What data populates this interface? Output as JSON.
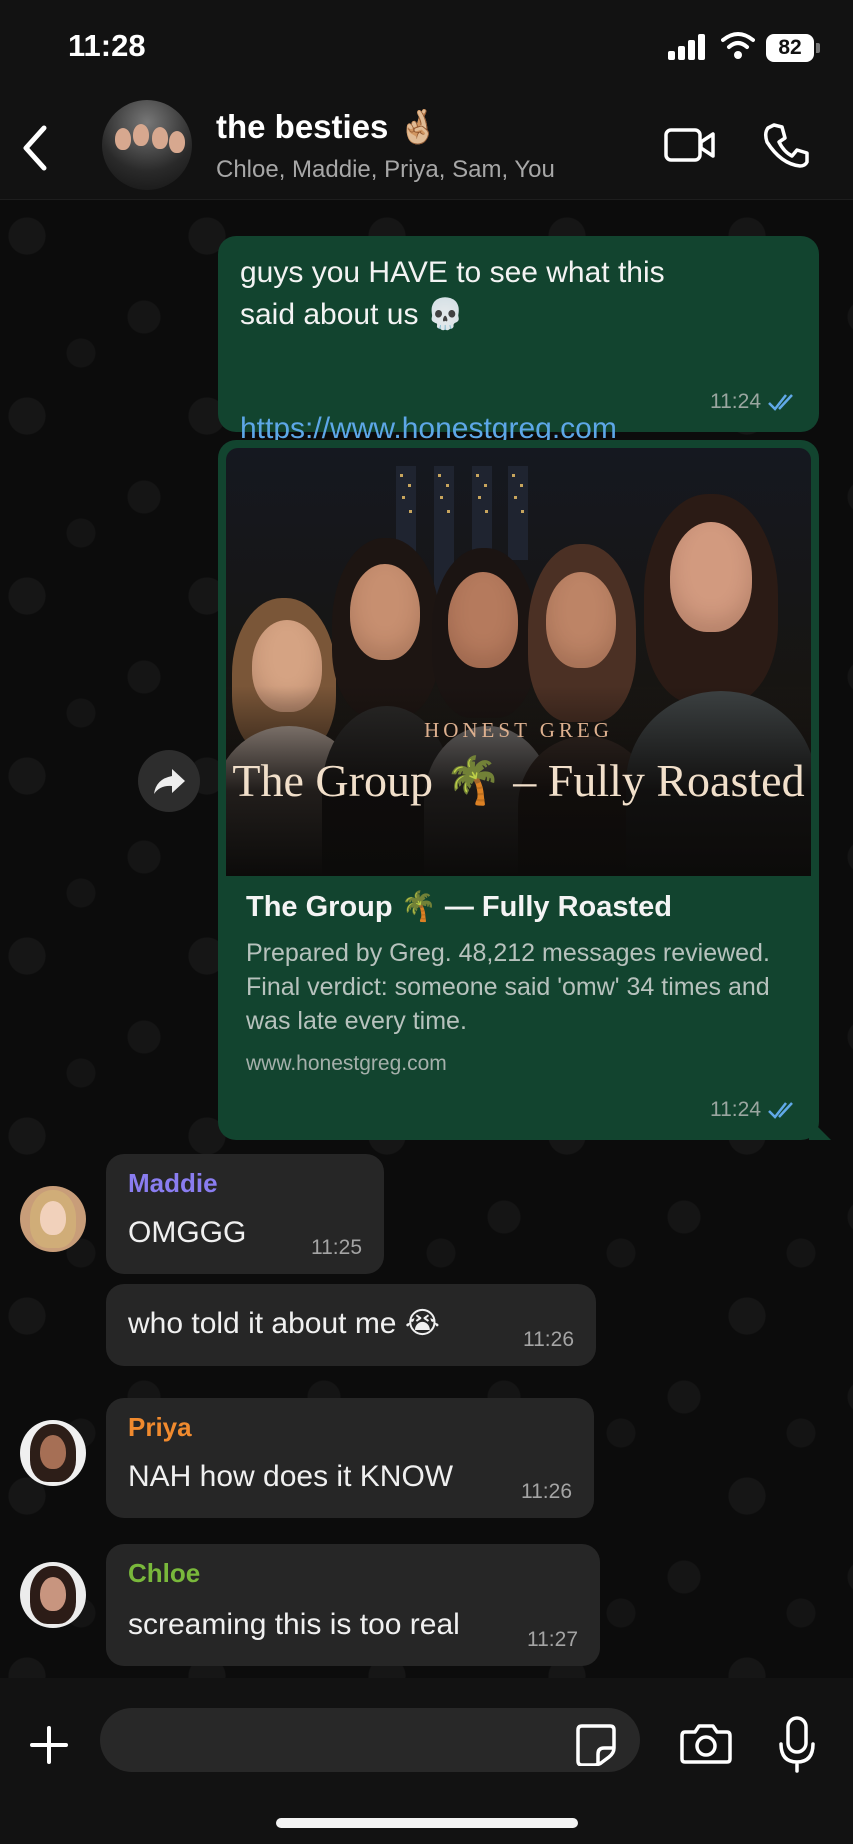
{
  "status_bar": {
    "time": "11:28",
    "battery": "82",
    "icons": [
      "signal-icon",
      "wifi-icon",
      "battery-icon"
    ]
  },
  "header": {
    "title": "the besties 🤞🏼",
    "members": "Chloe, Maddie, Priya, Sam, You",
    "icons": [
      "back-icon",
      "video-call-icon",
      "phone-call-icon"
    ]
  },
  "chat": {
    "outgoing_message": {
      "text": "guys you HAVE to see what this\nsaid about us 💀",
      "link": "https://www.honestgreg.com",
      "time": "11:24"
    },
    "link_preview": {
      "image_brand": "HONEST GREG",
      "image_title": "The Group 🌴 – Fully Roasted",
      "title": "The Group 🌴 — Fully Roasted",
      "description": "Prepared by Greg. 48,212 messages reviewed. Final verdict: someone said 'omw' 34 times and was late every time.",
      "domain": "www.honestgreg.com",
      "time": "11:24"
    },
    "incoming_messages": [
      {
        "sender": "Maddie",
        "text": "OMGGG",
        "time": "11:25"
      },
      {
        "sender": "",
        "text": "who told it about me 😭",
        "time": "11:26"
      },
      {
        "sender": "Priya",
        "text": "NAH how does it KNOW",
        "time": "11:26"
      },
      {
        "sender": "Chloe",
        "text": "screaming this is too real",
        "time": "11:27"
      }
    ]
  },
  "composer": {
    "placeholder": "",
    "icons": [
      "plus-icon",
      "sticker-icon",
      "camera-icon",
      "microphone-icon"
    ]
  },
  "colors": {
    "background": "#0c0c0c",
    "outgoing_bubble": "#12442f",
    "incoming_bubble": "#262626",
    "link": "#5da7e7",
    "maddie": "#8a7df0",
    "priya": "#f08a2e",
    "chloe": "#79b83b"
  }
}
